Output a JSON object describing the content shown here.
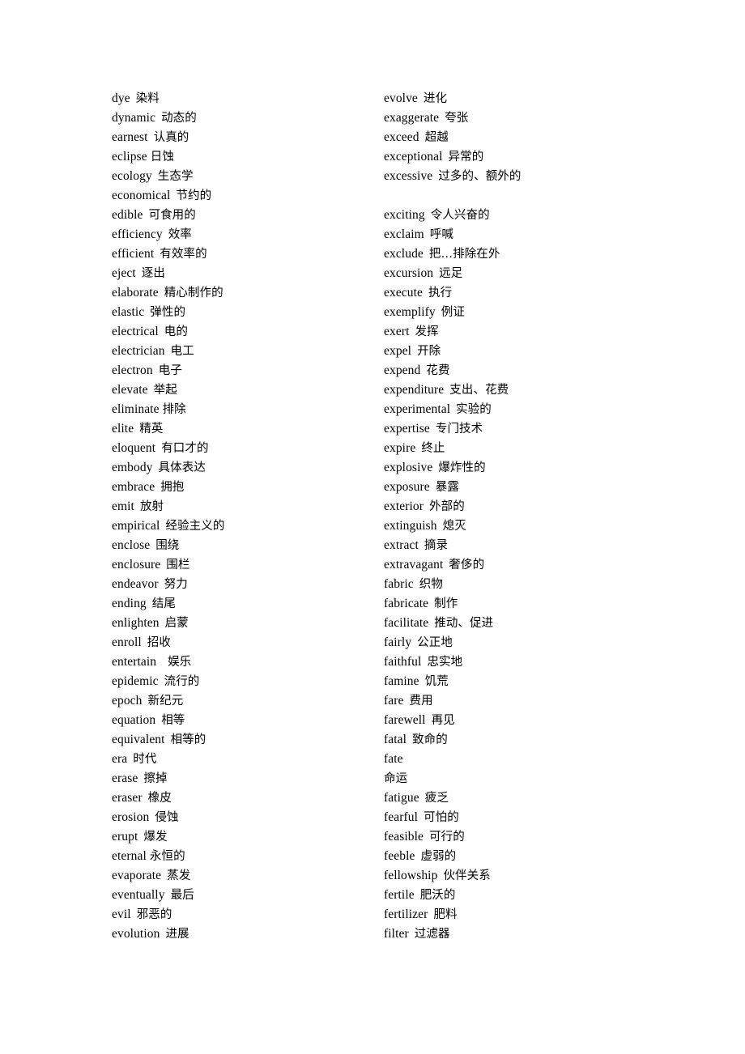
{
  "document": {
    "type": "vocabulary-word-list",
    "language_pair": "English-Chinese",
    "columns": 2
  },
  "left_column": [
    {
      "term": "dye",
      "gloss": "染料"
    },
    {
      "term": "dynamic",
      "gloss": "动态的"
    },
    {
      "term": "earnest",
      "gloss": "认真的"
    },
    {
      "term": "eclipse",
      "gloss": "日蚀",
      "tight": true
    },
    {
      "term": "ecology",
      "gloss": "生态学"
    },
    {
      "term": "economical",
      "gloss": "节约的"
    },
    {
      "term": "edible",
      "gloss": "可食用的"
    },
    {
      "term": "efficiency",
      "gloss": "效率"
    },
    {
      "term": "efficient",
      "gloss": "有效率的"
    },
    {
      "term": "eject",
      "gloss": "逐出"
    },
    {
      "term": "elaborate",
      "gloss": "精心制作的"
    },
    {
      "term": "elastic",
      "gloss": "弹性的"
    },
    {
      "term": "electrical",
      "gloss": "电的"
    },
    {
      "term": "electrician",
      "gloss": "电工"
    },
    {
      "term": "electron",
      "gloss": "电子"
    },
    {
      "term": "elevate",
      "gloss": "举起"
    },
    {
      "term": "eliminate",
      "gloss": "排除",
      "tight": true
    },
    {
      "term": "elite",
      "gloss": "精英"
    },
    {
      "term": "eloquent",
      "gloss": "有口才的"
    },
    {
      "term": "embody",
      "gloss": "具体表达"
    },
    {
      "term": "embrace",
      "gloss": "拥抱"
    },
    {
      "term": "emit",
      "gloss": "放射"
    },
    {
      "term": "empirical",
      "gloss": "经验主义的"
    },
    {
      "term": "enclose",
      "gloss": "围绕"
    },
    {
      "term": "enclosure",
      "gloss": "围栏"
    },
    {
      "term": "endeavor",
      "gloss": "努力"
    },
    {
      "term": "ending",
      "gloss": "结尾"
    },
    {
      "term": "enlighten",
      "gloss": "启蒙"
    },
    {
      "term": "enroll",
      "gloss": "招收"
    },
    {
      "term": "entertain",
      "gloss": "娱乐",
      "wide": true
    },
    {
      "term": "epidemic",
      "gloss": "流行的"
    },
    {
      "term": "epoch",
      "gloss": "新纪元"
    },
    {
      "term": "equation",
      "gloss": "相等"
    },
    {
      "term": "equivalent",
      "gloss": "相等的"
    },
    {
      "term": "era",
      "gloss": "时代"
    },
    {
      "term": "erase",
      "gloss": "擦掉"
    },
    {
      "term": "eraser",
      "gloss": "橡皮"
    },
    {
      "term": "erosion",
      "gloss": "侵蚀"
    },
    {
      "term": "erupt",
      "gloss": "爆发"
    },
    {
      "term": "eternal",
      "gloss": "永恒的",
      "tight": true
    },
    {
      "term": "evaporate",
      "gloss": "蒸发"
    },
    {
      "term": "eventually",
      "gloss": "最后"
    },
    {
      "term": "evil",
      "gloss": "邪恶的"
    },
    {
      "term": "evolution",
      "gloss": "进展"
    }
  ],
  "right_column": [
    {
      "term": "evolve",
      "gloss": "进化"
    },
    {
      "term": "exaggerate",
      "gloss": "夸张"
    },
    {
      "term": "exceed",
      "gloss": "超越"
    },
    {
      "term": "exceptional",
      "gloss": "异常的"
    },
    {
      "term": "excessive",
      "gloss": "过多的、额外的"
    },
    {
      "blank": true
    },
    {
      "term": "exciting",
      "gloss": "令人兴奋的"
    },
    {
      "term": "exclaim",
      "gloss": "呼喊"
    },
    {
      "term": "exclude",
      "gloss": "把…排除在外"
    },
    {
      "term": "excursion",
      "gloss": "远足"
    },
    {
      "term": "execute",
      "gloss": "执行"
    },
    {
      "term": "exemplify",
      "gloss": "例证"
    },
    {
      "term": "exert",
      "gloss": "发挥"
    },
    {
      "term": "expel",
      "gloss": "开除"
    },
    {
      "term": "expend",
      "gloss": "花费"
    },
    {
      "term": "expenditure",
      "gloss": "支出、花费"
    },
    {
      "term": "experimental",
      "gloss": "实验的"
    },
    {
      "term": "expertise",
      "gloss": "专门技术"
    },
    {
      "term": "expire",
      "gloss": "终止"
    },
    {
      "term": "explosive",
      "gloss": "爆炸性的"
    },
    {
      "term": "exposure",
      "gloss": "暴露"
    },
    {
      "term": "exterior",
      "gloss": "外部的"
    },
    {
      "term": "extinguish",
      "gloss": "熄灭"
    },
    {
      "term": "extract",
      "gloss": "摘录"
    },
    {
      "term": "extravagant",
      "gloss": "奢侈的"
    },
    {
      "term": "fabric",
      "gloss": "织物"
    },
    {
      "term": "fabricate",
      "gloss": "制作"
    },
    {
      "term": "facilitate",
      "gloss": "推动、促进"
    },
    {
      "term": "fairly",
      "gloss": "公正地"
    },
    {
      "term": "faithful",
      "gloss": "忠实地"
    },
    {
      "term": "famine",
      "gloss": "饥荒"
    },
    {
      "term": "fare",
      "gloss": "费用"
    },
    {
      "term": "farewell",
      "gloss": "再见"
    },
    {
      "term": "fatal",
      "gloss": "致命的"
    },
    {
      "term": "fate",
      "gloss": ""
    },
    {
      "term": "",
      "gloss": "命运",
      "gloss_only": true
    },
    {
      "term": "fatigue",
      "gloss": "疲乏"
    },
    {
      "term": "fearful",
      "gloss": "可怕的"
    },
    {
      "term": "feasible",
      "gloss": "可行的"
    },
    {
      "term": "feeble",
      "gloss": "虚弱的"
    },
    {
      "term": "fellowship",
      "gloss": "伙伴关系"
    },
    {
      "term": "fertile",
      "gloss": "肥沃的"
    },
    {
      "term": "fertilizer",
      "gloss": "肥料"
    },
    {
      "term": "filter",
      "gloss": "过滤器"
    }
  ]
}
